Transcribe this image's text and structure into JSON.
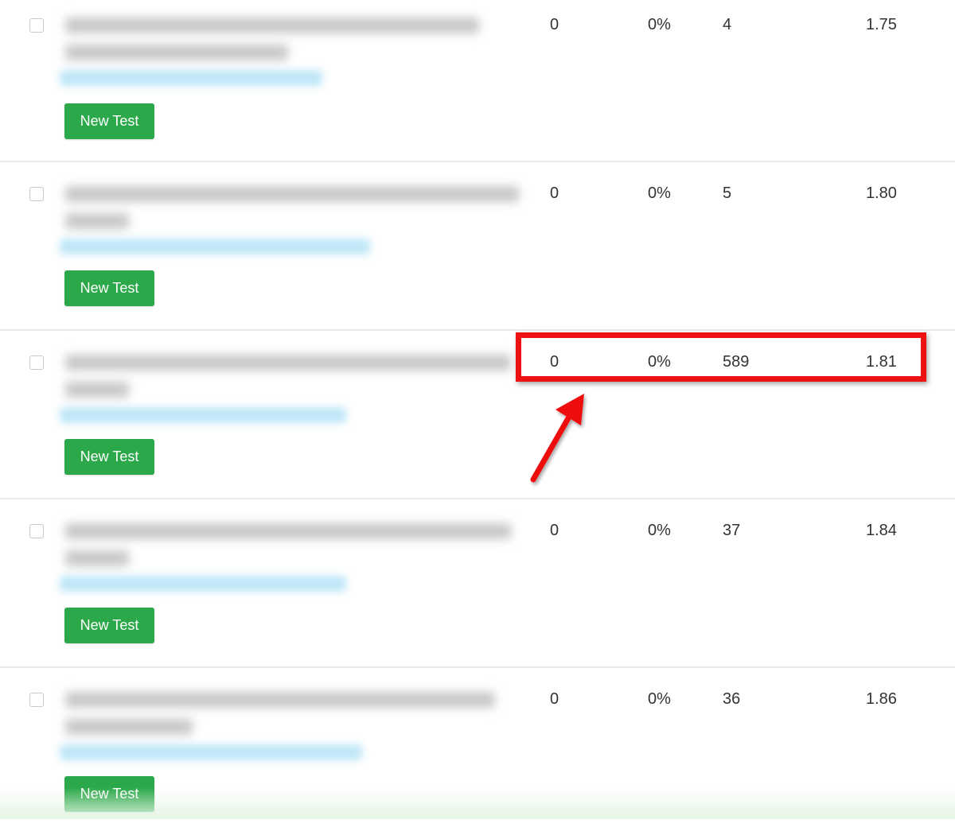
{
  "rows": [
    {
      "button_label": "New Test",
      "col1": "0",
      "col2": "0%",
      "col3": "4",
      "col4": "1.75"
    },
    {
      "button_label": "New Test",
      "col1": "0",
      "col2": "0%",
      "col3": "5",
      "col4": "1.80"
    },
    {
      "button_label": "New Test",
      "col1": "0",
      "col2": "0%",
      "col3": "589",
      "col4": "1.81"
    },
    {
      "button_label": "New Test",
      "col1": "0",
      "col2": "0%",
      "col3": "37",
      "col4": "1.84"
    },
    {
      "button_label": "New Test",
      "col1": "0",
      "col2": "0%",
      "col3": "36",
      "col4": "1.86"
    }
  ],
  "annotation": {
    "highlight_color": "#ee1111",
    "arrow_icon": "red-arrow-up-right"
  },
  "colors": {
    "button_green": "#2ba84a",
    "link_blur": "#bfe7f7"
  }
}
